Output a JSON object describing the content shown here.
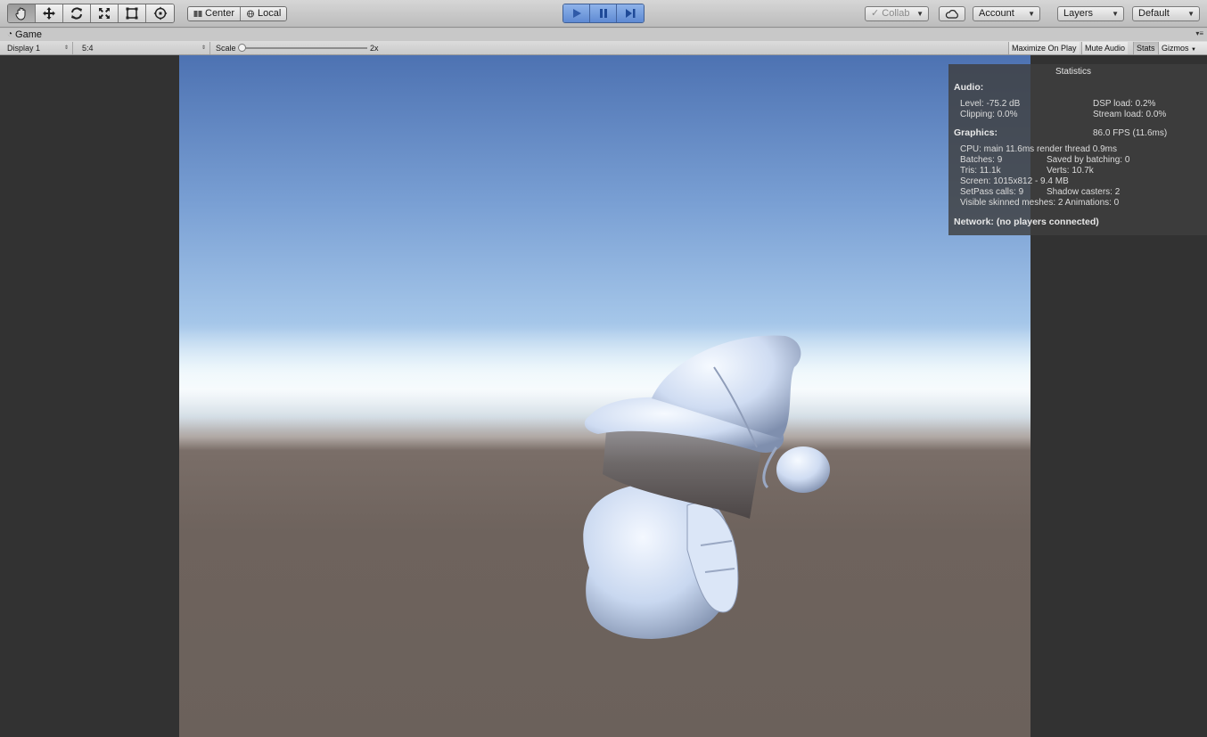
{
  "toolbar": {
    "tools": [
      {
        "name": "hand-tool",
        "icon": "hand-icon"
      },
      {
        "name": "move-tool",
        "icon": "move-icon"
      },
      {
        "name": "rotate-tool",
        "icon": "rotate-icon"
      },
      {
        "name": "scale-tool",
        "icon": "scale-icon"
      },
      {
        "name": "rect-tool",
        "icon": "rect-icon"
      },
      {
        "name": "transform-tool",
        "icon": "transform-icon"
      }
    ],
    "pivot_label": "Center",
    "rotation_label": "Local",
    "collab_label": "Collab",
    "account_label": "Account",
    "layers_label": "Layers",
    "layout_label": "Default",
    "accent_color": "#5e8ad3"
  },
  "game_view": {
    "tab_label": "Game",
    "display": "Display 1",
    "aspect": "5:4",
    "scale_label": "Scale",
    "scale_value": "2x",
    "buttons": {
      "maximize": "Maximize On Play",
      "mute": "Mute Audio",
      "stats": "Stats",
      "gizmos": "Gizmos"
    }
  },
  "stats": {
    "title": "Statistics",
    "audio_header": "Audio:",
    "level": "Level: -75.2 dB",
    "clipping": "Clipping: 0.0%",
    "dsp_load": "DSP load: 0.2%",
    "stream_load": "Stream load: 0.0%",
    "graphics_header": "Graphics:",
    "fps": "86.0 FPS (11.6ms)",
    "cpu": "CPU: main 11.6ms  render thread 0.9ms",
    "batches": "Batches: 9",
    "saved_batching": "Saved by batching: 0",
    "tris": "Tris: 11.1k",
    "verts": "Verts: 10.7k",
    "screen": "Screen: 1015x812 - 9.4 MB",
    "setpass": "SetPass calls: 9",
    "shadow_casters": "Shadow casters: 2",
    "skinned": "Visible skinned meshes: 2  Animations: 0",
    "network": "Network: (no players connected)"
  }
}
